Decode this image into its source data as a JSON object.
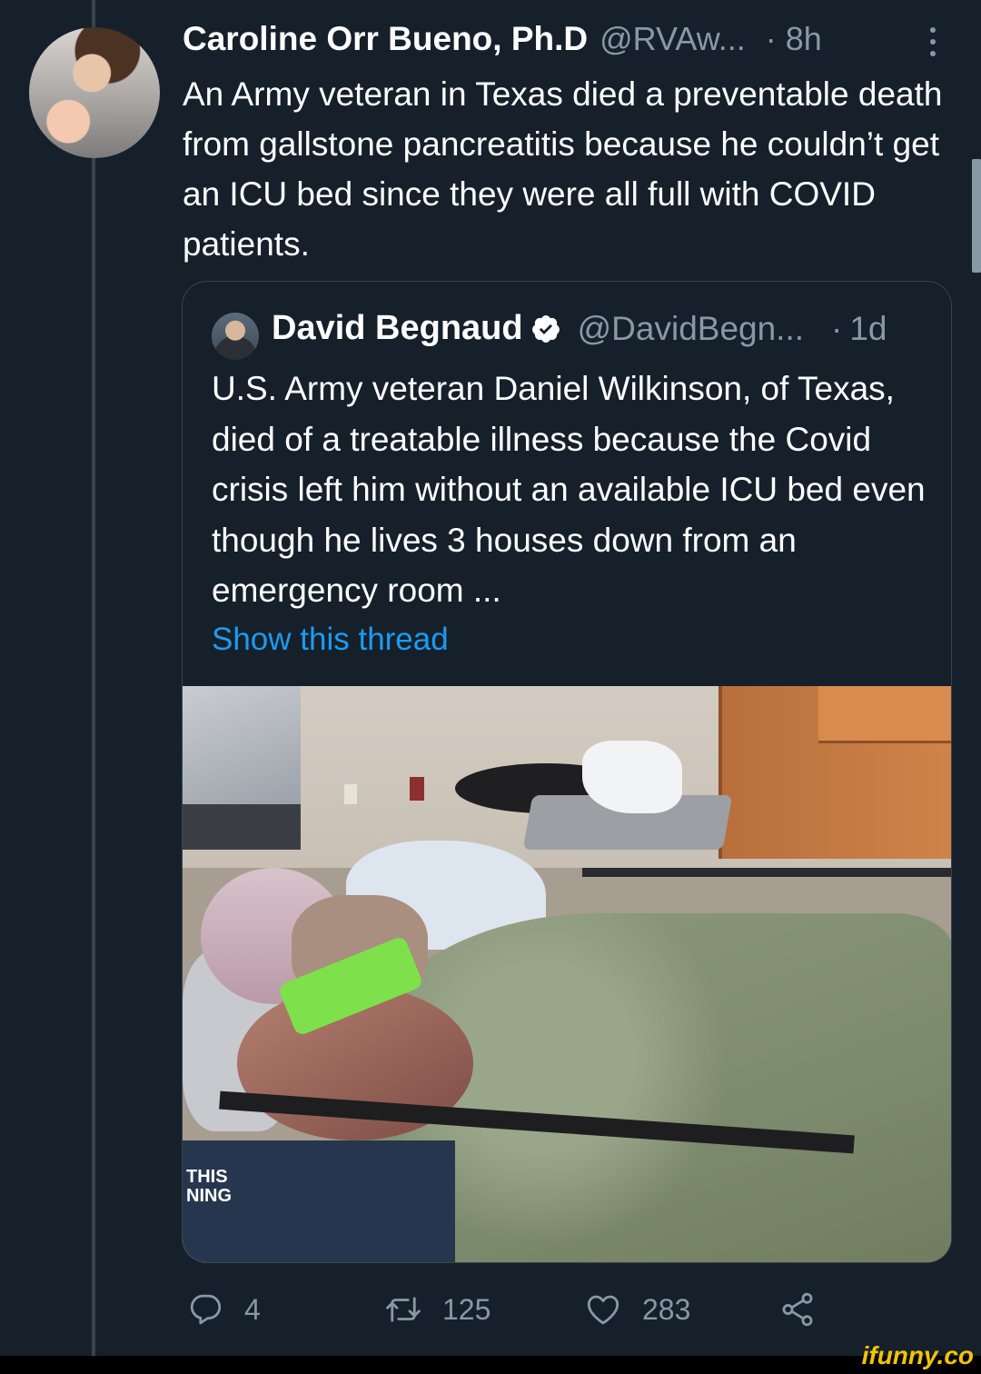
{
  "tweet": {
    "author_name": "Caroline Orr Bueno, Ph.D",
    "author_handle": "@RVAw...",
    "separator": "·",
    "time": "8h",
    "text": "An Army veteran in Texas died a preventable death from gallstone pancreatitis because he couldn’t get an ICU bed since they were all full with COVID patients."
  },
  "quoted_tweet": {
    "author_name": "David Begnaud",
    "verified": true,
    "author_handle": "@DavidBegn...",
    "separator": "·",
    "time": "1d",
    "text": "U.S. Army veteran Daniel Wilkinson, of Texas, died of a treatable illness because the Covid crisis left him without an available ICU bed even though he lives 3 houses down from an emergency room ...",
    "show_thread_label": "Show this thread",
    "media_overlay_text": [
      "THIS",
      "NING"
    ]
  },
  "actions": {
    "reply_count": "4",
    "retweet_count": "125",
    "like_count": "283"
  },
  "watermark": "ifunny.co",
  "colors": {
    "background": "#15202b",
    "border": "#38444d",
    "secondary_text": "#8899a6",
    "link": "#1d9bf0",
    "watermark": "#f2c400"
  },
  "icons": [
    "more-icon",
    "verified-badge-icon",
    "reply-icon",
    "retweet-icon",
    "like-icon",
    "share-icon"
  ]
}
